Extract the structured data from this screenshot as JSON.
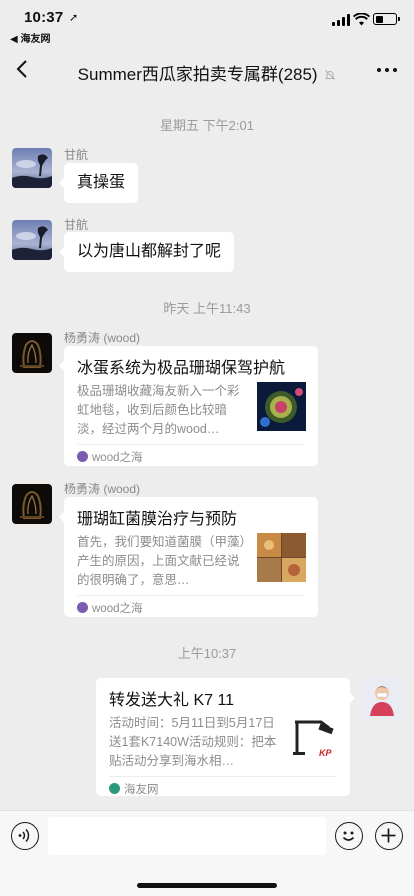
{
  "status_bar": {
    "time": "10:37",
    "back_app": "◀ 海友网"
  },
  "header": {
    "title": "Summer西瓜家拍卖专属群(285)"
  },
  "messages": [
    {
      "type": "timestamp",
      "text": "星期五 下午2:01"
    },
    {
      "type": "text",
      "sender": "甘航",
      "text": "真操蛋"
    },
    {
      "type": "text",
      "sender": "甘航",
      "text": "以为唐山都解封了呢"
    },
    {
      "type": "timestamp",
      "text": "昨天 上午11:43"
    },
    {
      "type": "card",
      "sender": "杨勇涛 (wood)",
      "title": "冰蛋系统为极品珊瑚保驾护航",
      "desc": "极品珊瑚收藏海友新入一个彩虹地毯，收到后颜色比较暗淡，经过两个月的wood…",
      "source": "wood之海"
    },
    {
      "type": "card",
      "sender": "杨勇涛 (wood)",
      "title": "珊瑚缸菌膜治疗与预防",
      "desc": "首先，我们要知道菌膜（甲藻）产生的原因，上面文献已经说的很明确了，意思…",
      "source": "wood之海"
    },
    {
      "type": "timestamp",
      "text": "上午10:37"
    },
    {
      "type": "card",
      "sender": "",
      "title": "转发送大礼 K7 11",
      "desc": "活动时间：5月11日到5月17日送1套K7140W活动规则：把本贴活动分享到海水相…",
      "source": "海友网",
      "thumb_logo": "KP"
    }
  ],
  "icons": {
    "back": "chevron-left-icon",
    "mute": "bell-off-icon",
    "more": "more-dots-icon",
    "voice": "voice-icon",
    "emoji": "emoji-icon",
    "plus": "plus-icon"
  },
  "colors": {
    "background": "#ededed",
    "bubble": "#ffffff",
    "meta_text": "#9b9b9b"
  }
}
